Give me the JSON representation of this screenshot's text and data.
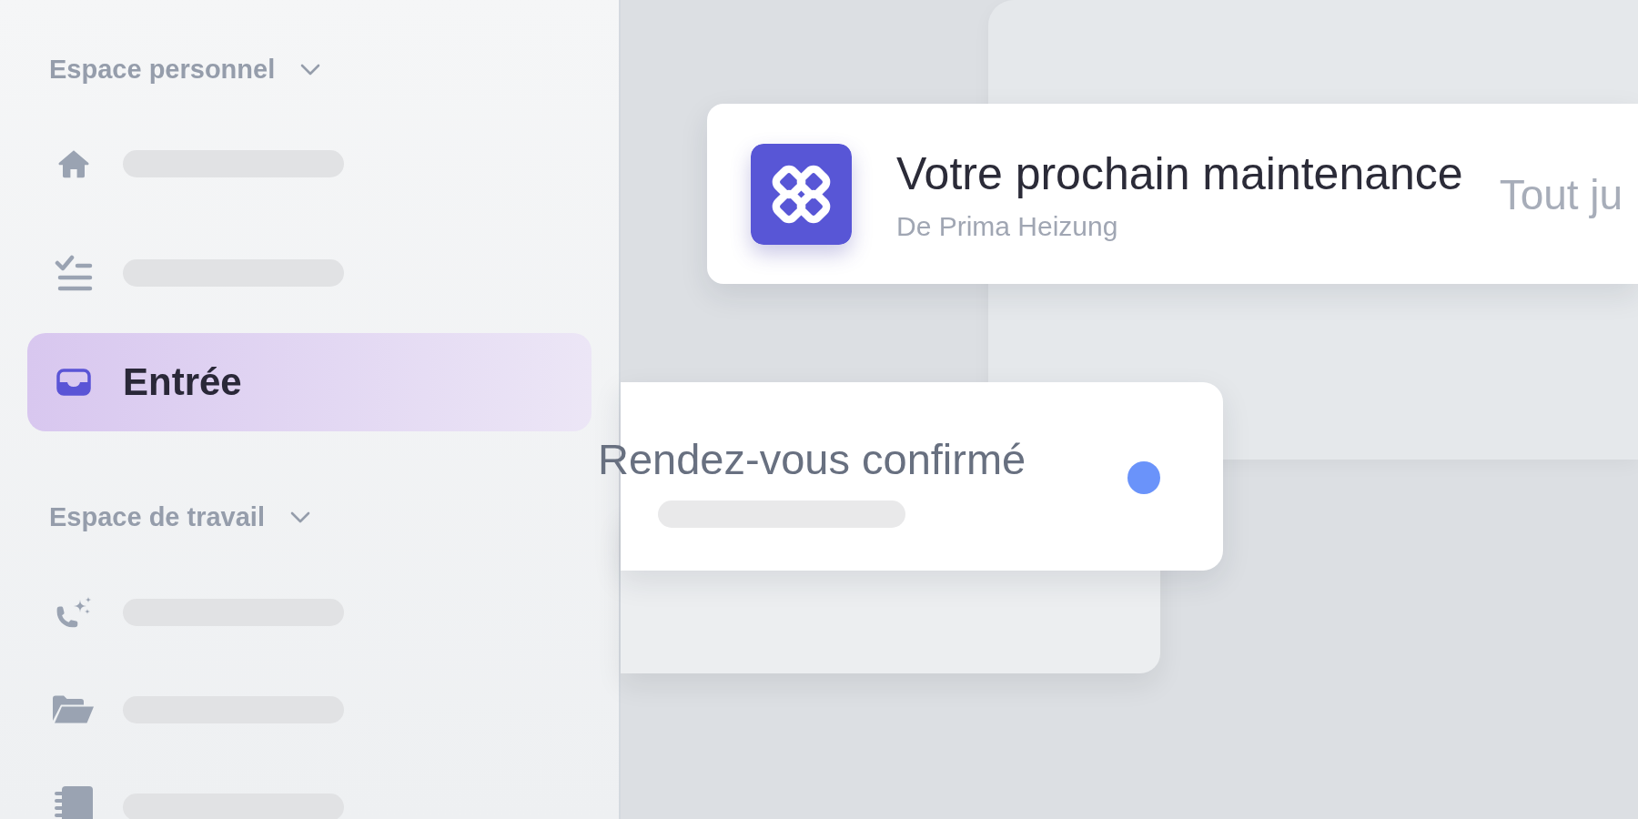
{
  "sidebar": {
    "sections": [
      {
        "title": "Espace personnel",
        "expanded": true,
        "items": [
          {
            "selected": false
          },
          {
            "selected": false
          },
          {
            "label": "Entrée",
            "selected": true
          }
        ]
      },
      {
        "title": "Espace de travail",
        "expanded": true,
        "items": [
          {
            "selected": false
          },
          {
            "selected": false
          },
          {
            "selected": false
          }
        ]
      }
    ]
  },
  "notification": {
    "title": "Votre prochain maintenance",
    "sender": "De Prima Heizung",
    "time": "Tout ju"
  },
  "appointment": {
    "title": "Rendez-vous confirmé",
    "unread": true
  }
}
